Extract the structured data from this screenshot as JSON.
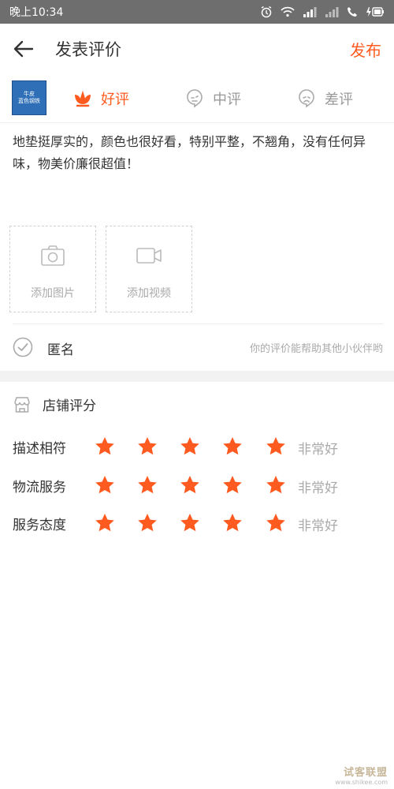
{
  "status_bar": {
    "time": "晚上10:34"
  },
  "header": {
    "title": "发表评价",
    "publish_label": "发布"
  },
  "product": {
    "thumb_line1": "牛皮",
    "thumb_line2": "蓝色钢铁"
  },
  "rating_options": [
    {
      "label": "好评",
      "selected": true
    },
    {
      "label": "中评",
      "selected": false
    },
    {
      "label": "差评",
      "selected": false
    }
  ],
  "review": {
    "text": "地垫挺厚实的，颜色也很好看，特别平整，不翘角，没有任何异味，物美价廉很超值！"
  },
  "upload": {
    "photo_label": "添加图片",
    "video_label": "添加视频"
  },
  "anonymous": {
    "label": "匿名",
    "hint": "你的评价能帮助其他小伙伴哟",
    "checked": false
  },
  "shop_rating": {
    "title": "店铺评分",
    "rows": [
      {
        "name": "描述相符",
        "stars": 5,
        "max": 5,
        "verdict": "非常好"
      },
      {
        "name": "物流服务",
        "stars": 5,
        "max": 5,
        "verdict": "非常好"
      },
      {
        "name": "服务态度",
        "stars": 5,
        "max": 5,
        "verdict": "非常好"
      }
    ]
  },
  "colors": {
    "accent": "#ff5a1f",
    "muted_text": "#aaaaaa",
    "status_bar": "#6e6e6e"
  },
  "icons": {
    "back": "arrow-left-icon",
    "good": "flower-icon",
    "mid": "neutral-face-icon",
    "bad": "sad-face-icon",
    "photo": "camera-icon",
    "video": "video-camera-icon",
    "anonymous": "check-circle-icon",
    "shop": "store-icon",
    "star": "star-icon"
  },
  "watermark": {
    "line1": "试客联盟",
    "line2": "www.shikee.com"
  }
}
